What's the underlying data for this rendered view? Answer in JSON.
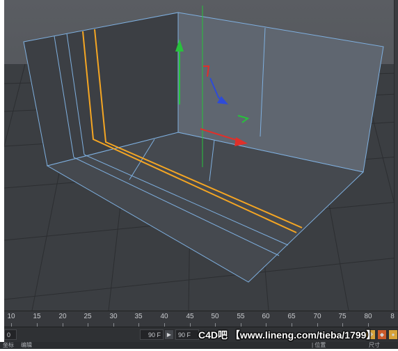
{
  "timeline": {
    "ticks": [
      "10",
      "15",
      "20",
      "25",
      "30",
      "35",
      "40",
      "45",
      "50",
      "55",
      "60",
      "65",
      "70",
      "75",
      "80",
      "8"
    ]
  },
  "transport": {
    "start_field": "0 F",
    "end_field_left": "90 F",
    "end_field_right": "90 F"
  },
  "watermark": "C4D吧 【www.lineng.com/tieba/1799】",
  "bottom_strip": {
    "left_a": "坐标",
    "left_b": "编辑",
    "mid": "| 位置",
    "right": "尺寸"
  },
  "colors": {
    "viewport_bg": "#4c5056",
    "floor": "#3b3e42",
    "wall_left": "#3c3f44",
    "wall_right": "#5f6670",
    "selection_edge": "#7fb0e0",
    "highlight_edge": "#f5a623",
    "axis_x": "#e0302a",
    "axis_y": "#27c23c",
    "axis_z": "#2e4bd8"
  },
  "icons": {
    "move_x": "x-axis-arrow-icon",
    "move_y": "y-axis-arrow-icon",
    "move_z": "z-axis-arrow-icon"
  }
}
